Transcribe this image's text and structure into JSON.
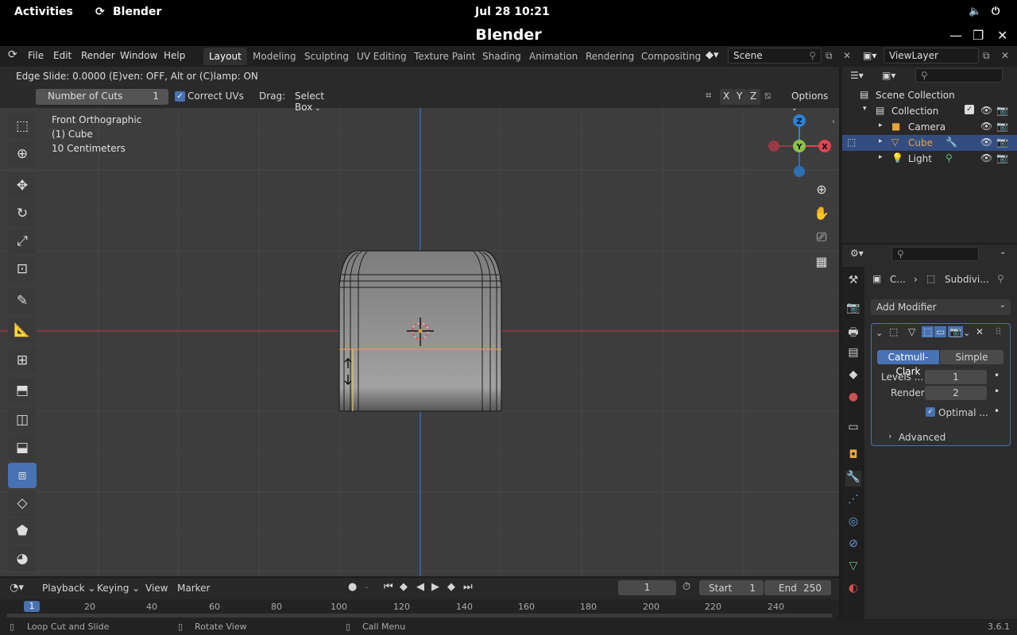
{
  "gnome": {
    "activities": "Activities",
    "app": "Blender",
    "clock": "Jul 28  10:21"
  },
  "window": {
    "title": "Blender"
  },
  "menu": [
    "File",
    "Edit",
    "Render",
    "Window",
    "Help"
  ],
  "workspaces": [
    "Layout",
    "Modeling",
    "Sculpting",
    "UV Editing",
    "Texture Paint",
    "Shading",
    "Animation",
    "Rendering",
    "Compositing"
  ],
  "scene": "Scene",
  "view_layer": "ViewLayer",
  "operator_hint": "Edge Slide: 0.0000 (E)ven: OFF, Alt or (C)lamp: ON",
  "tool_settings": {
    "cuts_label": "Number of Cuts",
    "cuts_value": "1",
    "correct_uvs": "Correct UVs",
    "drag_label": "Drag:",
    "drag_value": "Select Box",
    "axes": [
      "X",
      "Y",
      "Z"
    ],
    "options": "Options"
  },
  "viewport_info": {
    "view": "Front Orthographic",
    "object": "(1) Cube",
    "scale": "10 Centimeters"
  },
  "gizmo": {
    "z": "Z",
    "y": "Y",
    "x": "X"
  },
  "outliner": {
    "root": "Scene Collection",
    "collection": "Collection",
    "items": [
      {
        "name": "Camera",
        "selected": false
      },
      {
        "name": "Cube",
        "selected": true
      },
      {
        "name": "Light",
        "selected": false
      }
    ]
  },
  "properties": {
    "breadcrumb_object": "C...",
    "breadcrumb_modifier": "Subdivi...",
    "add_modifier": "Add Modifier",
    "mode_catmull": "Catmull-Clark",
    "mode_simple": "Simple",
    "levels_label": "Levels ...",
    "levels_value": "1",
    "render_label": "Render",
    "render_value": "2",
    "optimal_label": "Optimal ...",
    "advanced": "Advanced"
  },
  "timeline": {
    "menus": [
      "Playback",
      "Keying",
      "View",
      "Marker"
    ],
    "current_frame": "1",
    "start_label": "Start",
    "start_value": "1",
    "end_label": "End",
    "end_value": "250",
    "ticks": [
      "20",
      "40",
      "60",
      "80",
      "100",
      "120",
      "140",
      "160",
      "180",
      "200",
      "220",
      "240"
    ],
    "playhead": "1"
  },
  "status": {
    "left": "Loop Cut and Slide",
    "middle": "Rotate View",
    "right": "Call Menu",
    "version": "3.6.1"
  },
  "colors": {
    "accent": "#4772b3",
    "x_axis": "#e04453",
    "y_axis": "#8bc34a",
    "z_axis": "#2d82d1",
    "viewport": "#3d3d3d"
  }
}
